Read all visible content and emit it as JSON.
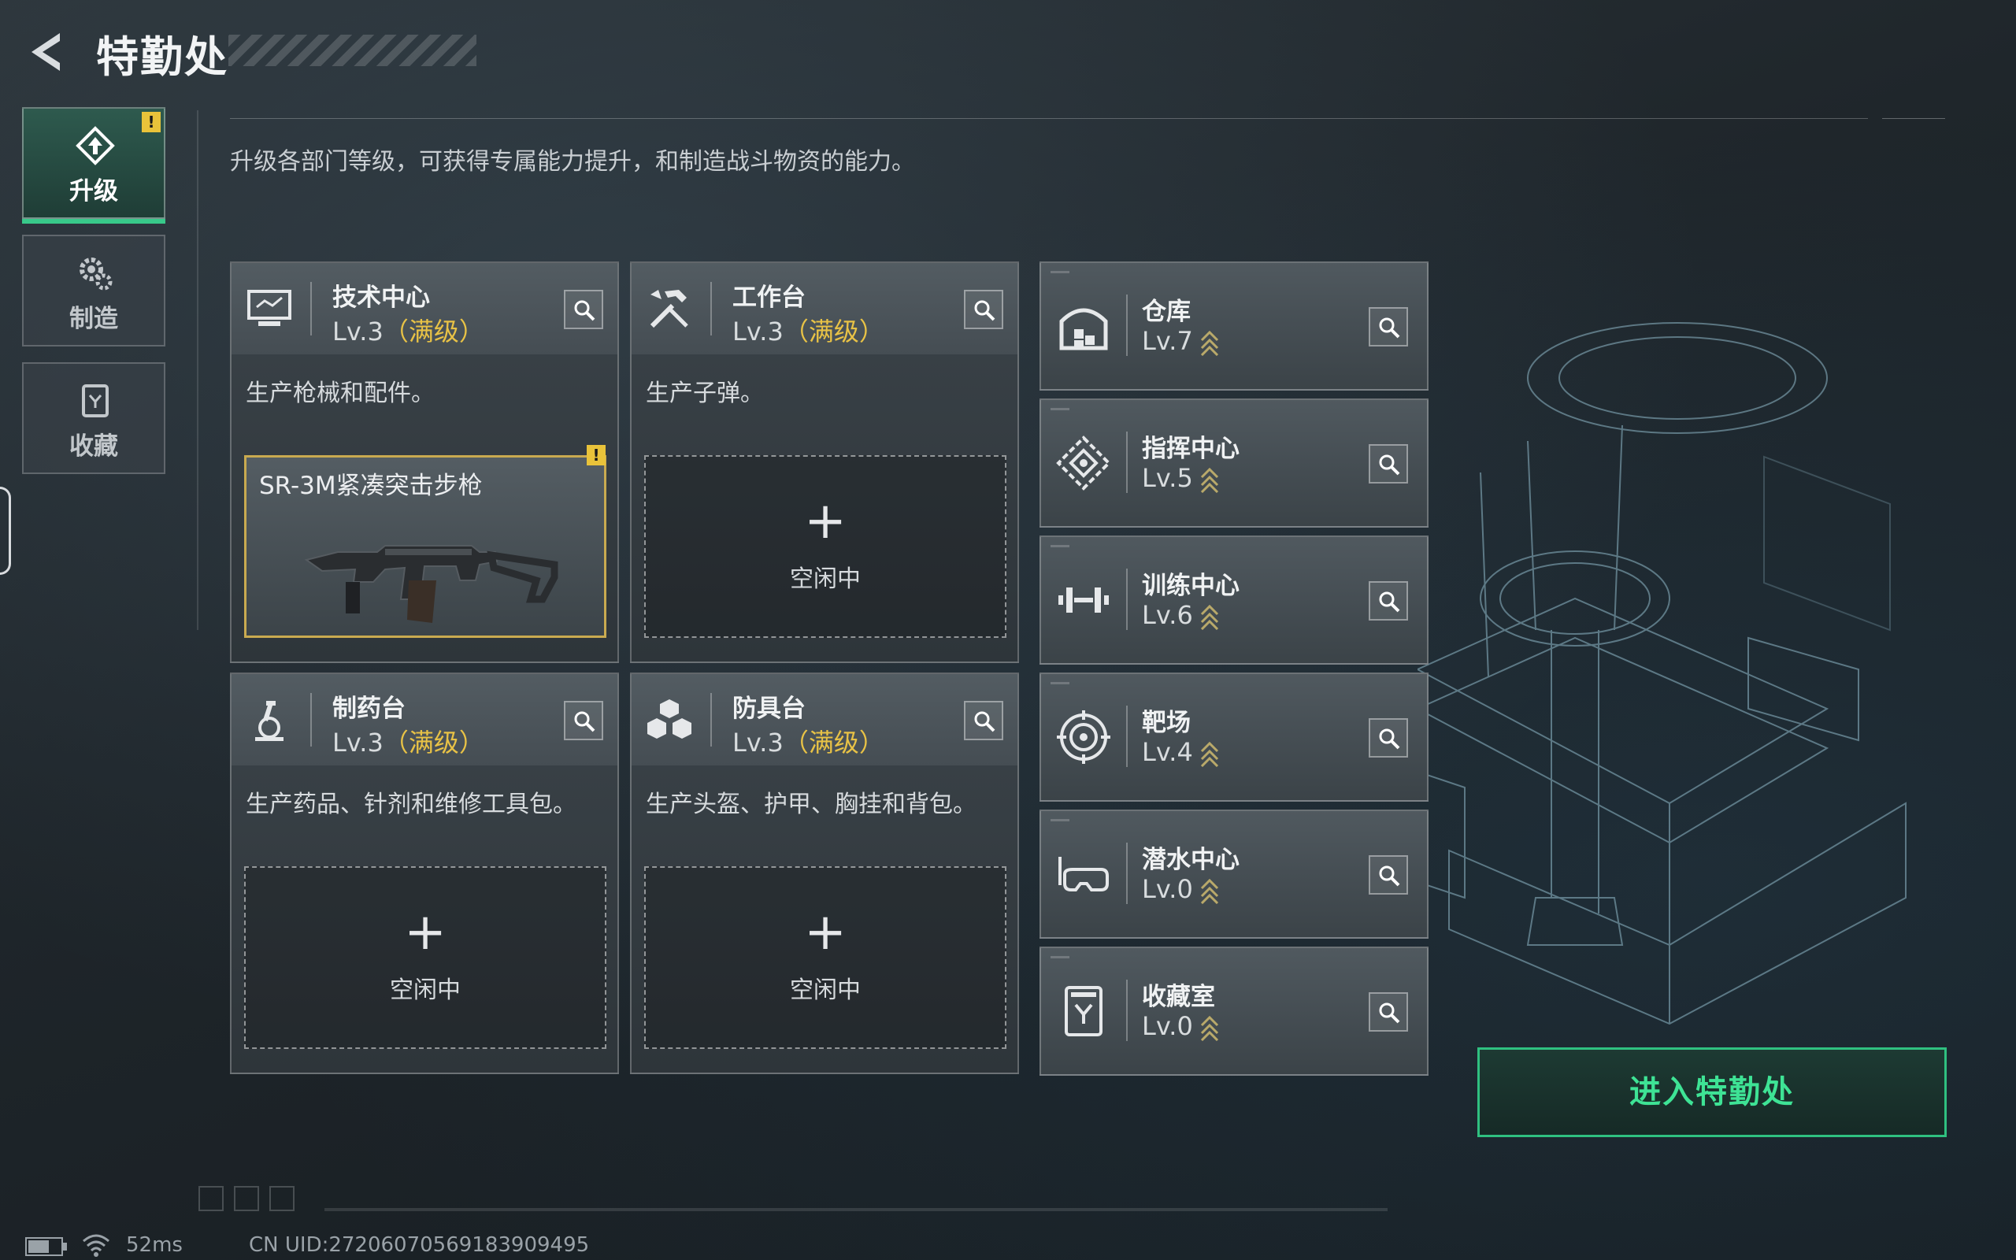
{
  "header": {
    "title": "特勤处",
    "subtitle": "升级各部门等级，可获得专属能力提升，和制造战斗物资的能力。"
  },
  "nav": [
    {
      "label": "升级",
      "icon": "upgrade-icon",
      "active": true,
      "alert": "!"
    },
    {
      "label": "制造",
      "icon": "gears-icon",
      "active": false
    },
    {
      "label": "收藏",
      "icon": "collection-icon",
      "active": false
    }
  ],
  "departments": [
    {
      "name": "技术中心",
      "level": "Lv.3",
      "max": "（满级）",
      "icon": "tech-center-icon",
      "desc": "生产枪械和配件。",
      "slot": {
        "filled": true,
        "item": "SR-3M紧凑突击步枪",
        "alert": "!"
      }
    },
    {
      "name": "工作台",
      "level": "Lv.3",
      "max": "（满级）",
      "icon": "workbench-icon",
      "desc": "生产子弹。",
      "slot": {
        "filled": false,
        "plus": "+",
        "status": "空闲中"
      }
    },
    {
      "name": "制药台",
      "level": "Lv.3",
      "max": "（满级）",
      "icon": "pharmacy-icon",
      "desc": "生产药品、针剂和维修工具包。",
      "slot": {
        "filled": false,
        "plus": "+",
        "status": "空闲中"
      }
    },
    {
      "name": "防具台",
      "level": "Lv.3",
      "max": "（满级）",
      "icon": "armor-bench-icon",
      "desc": "生产头盔、护甲、胸挂和背包。",
      "slot": {
        "filled": false,
        "plus": "+",
        "status": "空闲中"
      }
    }
  ],
  "facilities": [
    {
      "name": "仓库",
      "level": "Lv.7",
      "icon": "warehouse-icon"
    },
    {
      "name": "指挥中心",
      "level": "Lv.5",
      "icon": "command-center-icon"
    },
    {
      "name": "训练中心",
      "level": "Lv.6",
      "icon": "training-center-icon"
    },
    {
      "name": "靶场",
      "level": "Lv.4",
      "icon": "shooting-range-icon"
    },
    {
      "name": "潜水中心",
      "level": "Lv.0",
      "icon": "diving-center-icon"
    },
    {
      "name": "收藏室",
      "level": "Lv.0",
      "icon": "collection-room-icon"
    }
  ],
  "enter_button": "进入特勤处",
  "footer": {
    "ping": "52ms",
    "uid": "CN UID:272060705691839094​95"
  },
  "colors": {
    "accent": "#38c98a",
    "max_level": "#e8c246",
    "alert": "#e9c33a"
  }
}
